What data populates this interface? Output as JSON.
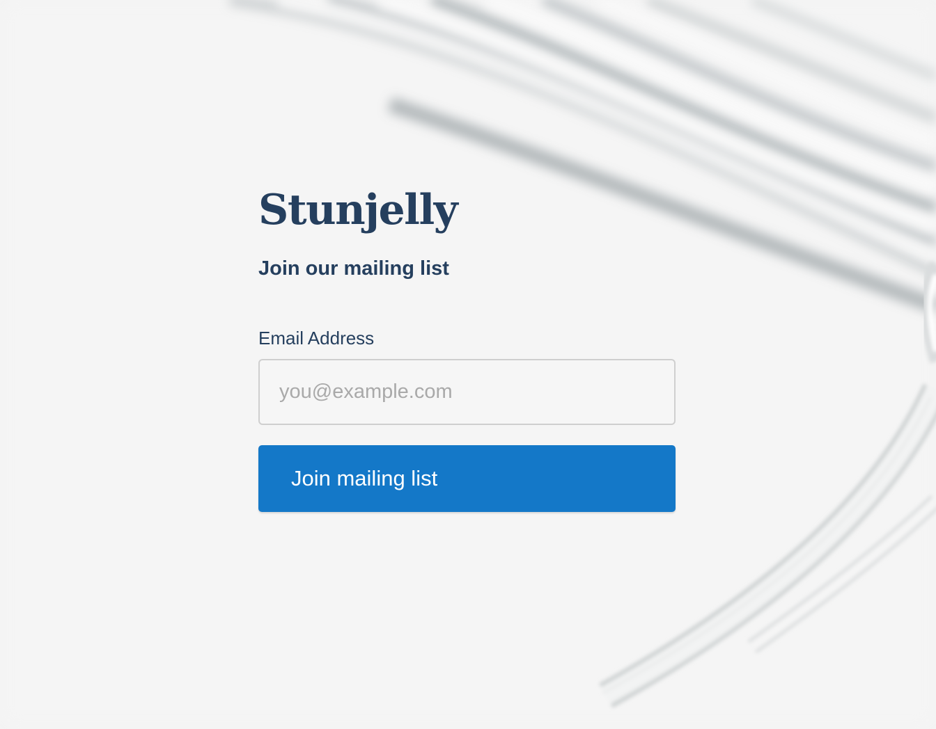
{
  "brand": {
    "name": "Stunjelly",
    "color": "#253f5e"
  },
  "form": {
    "subtitle": "Join our mailing list",
    "email_label": "Email Address",
    "email_placeholder": "you@example.com",
    "email_value": "",
    "submit_label": "Join mailing list"
  },
  "colors": {
    "background": "#f3f3f3",
    "accent": "#1478c8",
    "text": "#253f5e",
    "placeholder": "#a9a9a9"
  }
}
